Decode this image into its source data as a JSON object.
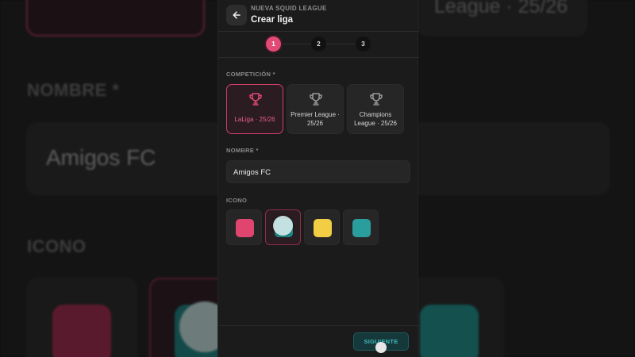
{
  "background": {
    "top_right_text": "League · 25/26",
    "name_label": "NOMBRE *",
    "name_value": "Amigos FC",
    "icon_label": "ICONO"
  },
  "header": {
    "supertitle": "NUEVA SQUID LEAGUE",
    "title": "Crear liga",
    "back_icon": "arrow-left-icon"
  },
  "stepper": {
    "steps": [
      "1",
      "2",
      "3"
    ],
    "active_step": 1
  },
  "competition": {
    "label": "COMPETICIÓN *",
    "options": [
      {
        "label": "LaLiga · 25/26",
        "selected": true,
        "icon": "trophy-icon"
      },
      {
        "label": "Premier League · 25/26",
        "selected": false,
        "icon": "trophy-icon"
      },
      {
        "label": "Champions League · 25/26",
        "selected": false,
        "icon": "trophy-icon"
      }
    ]
  },
  "name": {
    "label": "NOMBRE *",
    "value": "Amigos FC"
  },
  "icon": {
    "label": "ICONO",
    "options": [
      {
        "color": "#e0456f",
        "selected": false
      },
      {
        "color": "#1f8f8c",
        "selected": true
      },
      {
        "color": "#f2ce45",
        "selected": false
      },
      {
        "color": "#2a9e9c",
        "selected": false
      }
    ]
  },
  "footer": {
    "next_label": "SIGUIENTE"
  },
  "colors": {
    "accent": "#e24a76",
    "teal": "#3fb7b8",
    "panel": "#1b1b1b"
  }
}
